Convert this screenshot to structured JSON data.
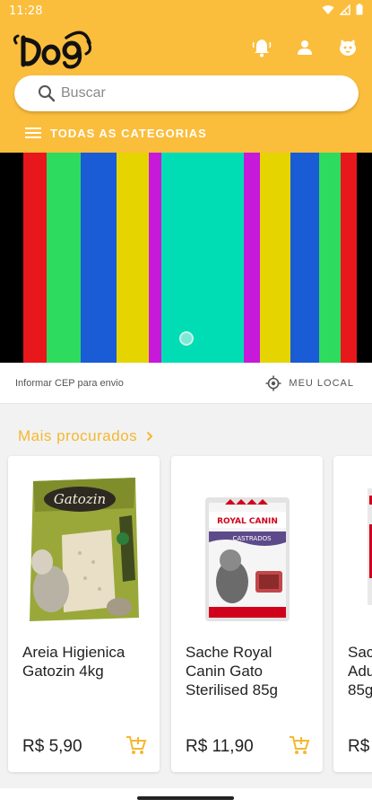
{
  "status_bar": {
    "time": "11:28"
  },
  "search": {
    "placeholder": "Buscar"
  },
  "nav": {
    "categories_label": "TODAS AS CATEGORIAS"
  },
  "banner": {
    "stripe_colors": [
      "#000000",
      "#e8171b",
      "#2ddc5e",
      "#1a5bd6",
      "#e5d400",
      "#c619d9",
      "#00dcb4",
      "#c619d9",
      "#e5d400",
      "#1a5bd6",
      "#2ddc5e",
      "#e8171b",
      "#000000"
    ]
  },
  "shipping": {
    "cep_label": "Informar CEP para envio",
    "location_label": "MEU LOCAL"
  },
  "section": {
    "title": "Mais procurados"
  },
  "products": [
    {
      "name": "Areia Higienica Gatozin 4kg",
      "price": "R$ 5,90"
    },
    {
      "name": "Sache Royal Canin Gato Sterilised 85g",
      "price": "R$ 11,90"
    },
    {
      "name": "Sac Adu 85g",
      "price": "R$"
    }
  ],
  "colors": {
    "brand": "#fbbd3c",
    "accent": "#f5b731"
  }
}
